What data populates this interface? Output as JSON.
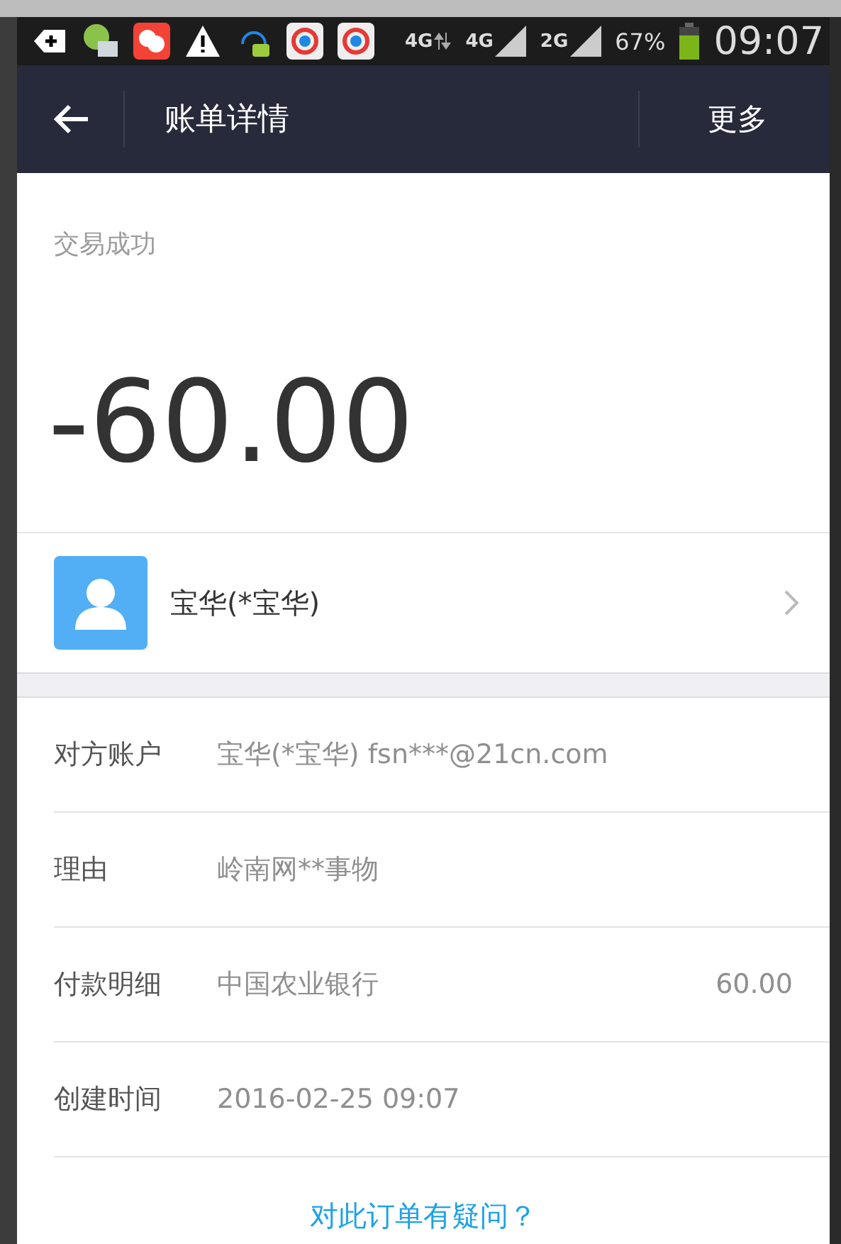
{
  "status_bar": {
    "network": [
      {
        "label": "4G",
        "kind": "data"
      },
      {
        "label": "4G",
        "kind": "signal"
      },
      {
        "label": "2G",
        "kind": "signal"
      }
    ],
    "battery": "67%",
    "time": "09:07"
  },
  "header": {
    "title": "账单详情",
    "action": "更多"
  },
  "status": "交易成功",
  "amount": "-60.00",
  "payee": {
    "name": "宝华(*宝华)"
  },
  "details": [
    {
      "label": "对方账户",
      "value": "宝华(*宝华) fsn***@21cn.com"
    },
    {
      "label": "理由",
      "value": "岭南网**事物"
    },
    {
      "label": "付款明细",
      "value": "中国农业银行",
      "amount": "60.00"
    },
    {
      "label": "创建时间",
      "value": "2016-02-25 09:07"
    }
  ],
  "help_link": "对此订单有疑问？"
}
